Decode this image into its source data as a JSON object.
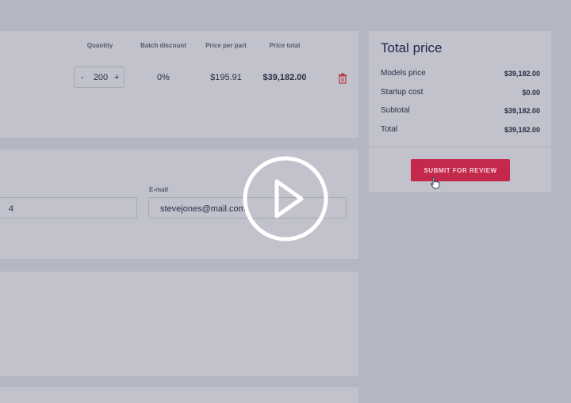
{
  "quote": {
    "headers": {
      "quantity": "Quantity",
      "batch_discount": "Batch discount",
      "price_per_part": "Price per part",
      "price_total": "Price total"
    },
    "row": {
      "quantity_minus": "-",
      "quantity": "200",
      "quantity_plus": "+",
      "batch_discount": "0%",
      "price_per_part": "$195.91",
      "price_total": "$39,182.00"
    }
  },
  "contact": {
    "phone_value": "4",
    "email_label": "E-mail",
    "email_value": "stevejones@mail.com"
  },
  "total": {
    "title": "Total price",
    "rows": [
      {
        "label": "Models price",
        "value": "$39,182.00"
      },
      {
        "label": "Startup cost",
        "value": "$0.00"
      },
      {
        "label": "Subtotal",
        "value": "$39,182.00"
      },
      {
        "label": "Total",
        "value": "$39,182.00"
      }
    ],
    "submit_label": "SUBMIT FOR REVIEW"
  },
  "colors": {
    "accent": "#c4284a",
    "overlay_bg": "#b5b6c3",
    "card_bg": "#c1c2cc",
    "title": "#1d2346"
  },
  "icons": {
    "delete": "trash-icon",
    "video": "play-icon",
    "pointer": "hand-cursor-icon"
  }
}
